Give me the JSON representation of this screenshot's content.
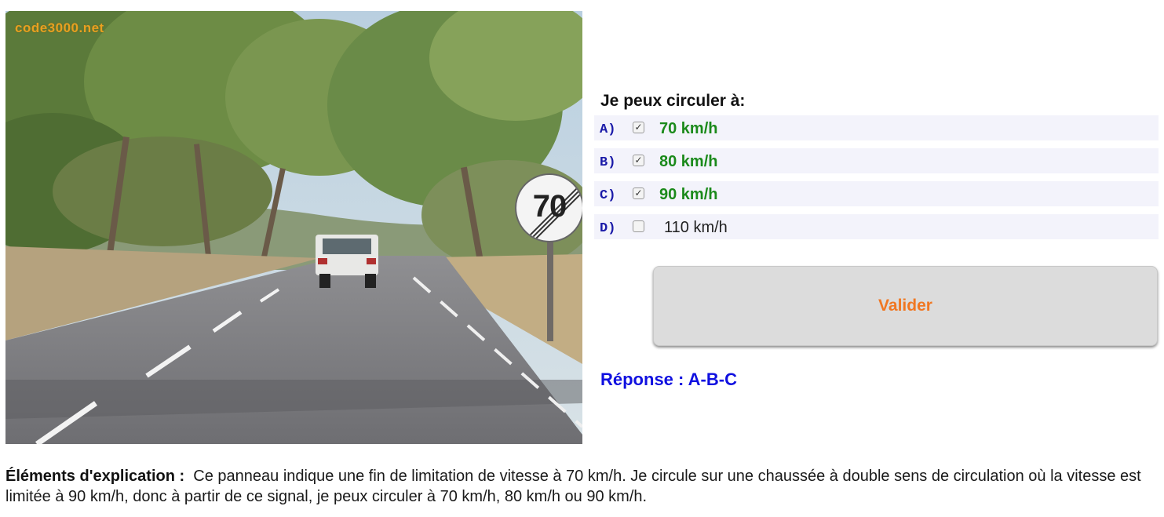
{
  "photo": {
    "watermark": "code3000.net",
    "sign_number": "70"
  },
  "question": {
    "title": "Je peux circuler à:",
    "options": [
      {
        "letter": "A)",
        "label": "70 km/h",
        "checked": true,
        "correct": true
      },
      {
        "letter": "B)",
        "label": "80 km/h",
        "checked": true,
        "correct": true
      },
      {
        "letter": "C)",
        "label": "90 km/h",
        "checked": true,
        "correct": true
      },
      {
        "letter": "D)",
        "label": "110 km/h",
        "checked": false,
        "correct": false
      }
    ]
  },
  "valider_label": "Valider",
  "answer": "Réponse : A-B-C",
  "explanation": {
    "heading": "Éléments d'explication :",
    "text": "Ce panneau indique une fin de limitation de vitesse à 70 km/h. Je circule sur une chaussée à double sens de circulation où la vitesse est limitée à 90 km/h, donc à partir de ce signal, je peux circuler à 70 km/h, 80 km/h ou 90 km/h."
  },
  "colors": {
    "option_letter": "#1a1aa8",
    "correct": "#1b8a1b",
    "answer": "#1010e0",
    "valider_text": "#f07722"
  }
}
